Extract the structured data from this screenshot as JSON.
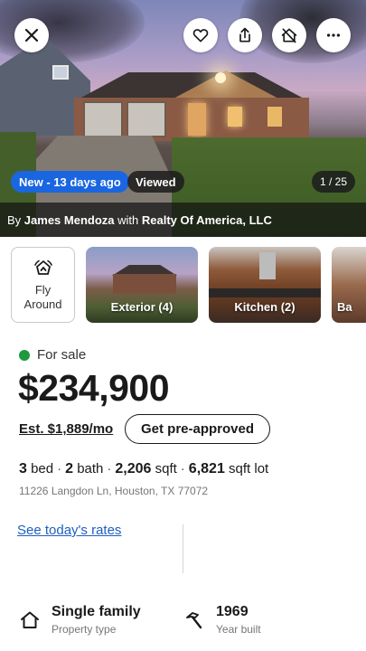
{
  "hero": {
    "badge_new": "New - 13 days ago",
    "badge_viewed": "Viewed",
    "photo_counter": "1 / 25",
    "agent": {
      "prefix": "By",
      "name": "James Mendoza",
      "with": "with",
      "brokerage": "Realty Of America, LLC"
    },
    "icons": {
      "close": "close-icon",
      "favorite": "heart-icon",
      "share": "share-icon",
      "hide": "hide-home-icon",
      "more": "more-icon"
    }
  },
  "carousel": {
    "fly_around_label": "Fly Around",
    "photos": [
      {
        "label": "Exterior (4)"
      },
      {
        "label": "Kitchen (2)"
      },
      {
        "label": "Ba"
      }
    ]
  },
  "listing": {
    "status": "For sale",
    "status_color": "#1e9a3c",
    "price": "$234,900",
    "est_payment": "Est. $1,889/mo",
    "preapproved_label": "Get pre-approved",
    "beds": "3",
    "beds_unit": "bed",
    "baths": "2",
    "baths_unit": "bath",
    "sqft": "2,206",
    "sqft_unit": "sqft",
    "lot": "6,821",
    "lot_unit": "sqft lot",
    "address": "11226 Langdon Ln, Houston, TX 77072",
    "rates_link": "See today's rates"
  },
  "features": {
    "property_type": {
      "value": "Single family",
      "label": "Property type"
    },
    "year_built": {
      "value": "1969",
      "label": "Year built"
    }
  },
  "colors": {
    "accent_blue": "#1a66e0",
    "link_blue": "#1f5fbf"
  }
}
